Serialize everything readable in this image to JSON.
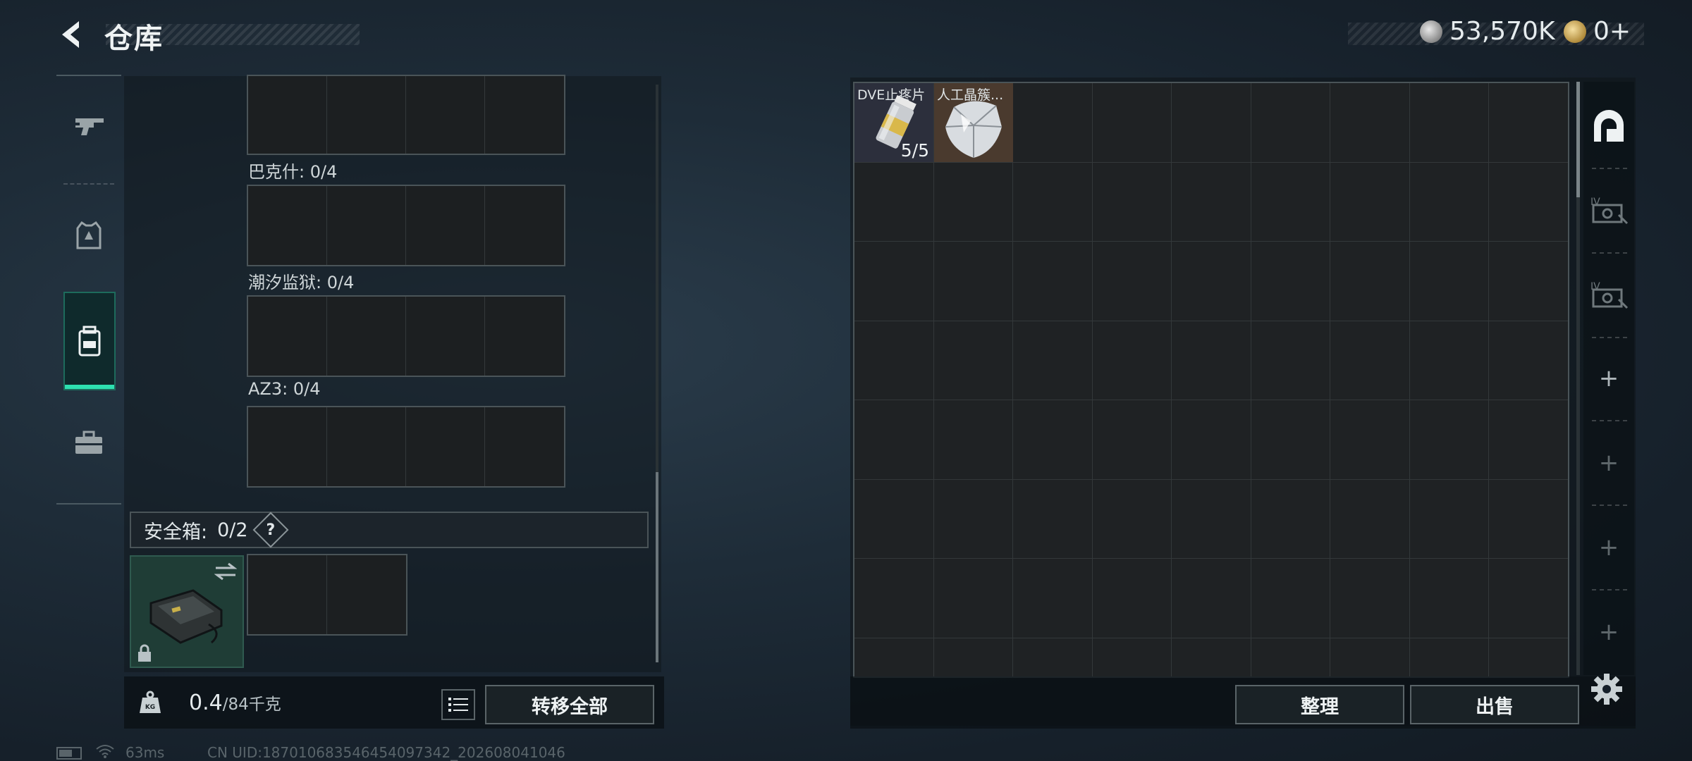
{
  "header": {
    "title": "仓库"
  },
  "currency": {
    "silver": "53,570K",
    "gold": "0+"
  },
  "left_tabs": [
    "weapon-tab",
    "armor-tab",
    "backpack-tab",
    "toolbox-tab"
  ],
  "backpack": {
    "slots": [
      {
        "label": "巴克什: 0/4"
      },
      {
        "label": "潮汐监狱: 0/4"
      },
      {
        "label": "AZ3: 0/4"
      }
    ],
    "safe_box_label": "安全箱:",
    "safe_box_count": "0/2",
    "help_label": "?",
    "weight_current": "0.4",
    "weight_max": "/84千克",
    "transfer_all_label": "转移全部"
  },
  "stash": {
    "items": [
      {
        "name": "DVE止疼片",
        "count": "5/5"
      },
      {
        "name": "人工晶簇...",
        "count": ""
      }
    ],
    "sort_label": "整理",
    "sell_label": "出售",
    "side_tabs": {
      "tier1": "IV",
      "tier2": "IV"
    }
  },
  "status": {
    "ping": "63ms",
    "uid": "CN UID:18701068354645409734​2_202608041046"
  },
  "colors": {
    "accent": "#2ee0b0"
  }
}
